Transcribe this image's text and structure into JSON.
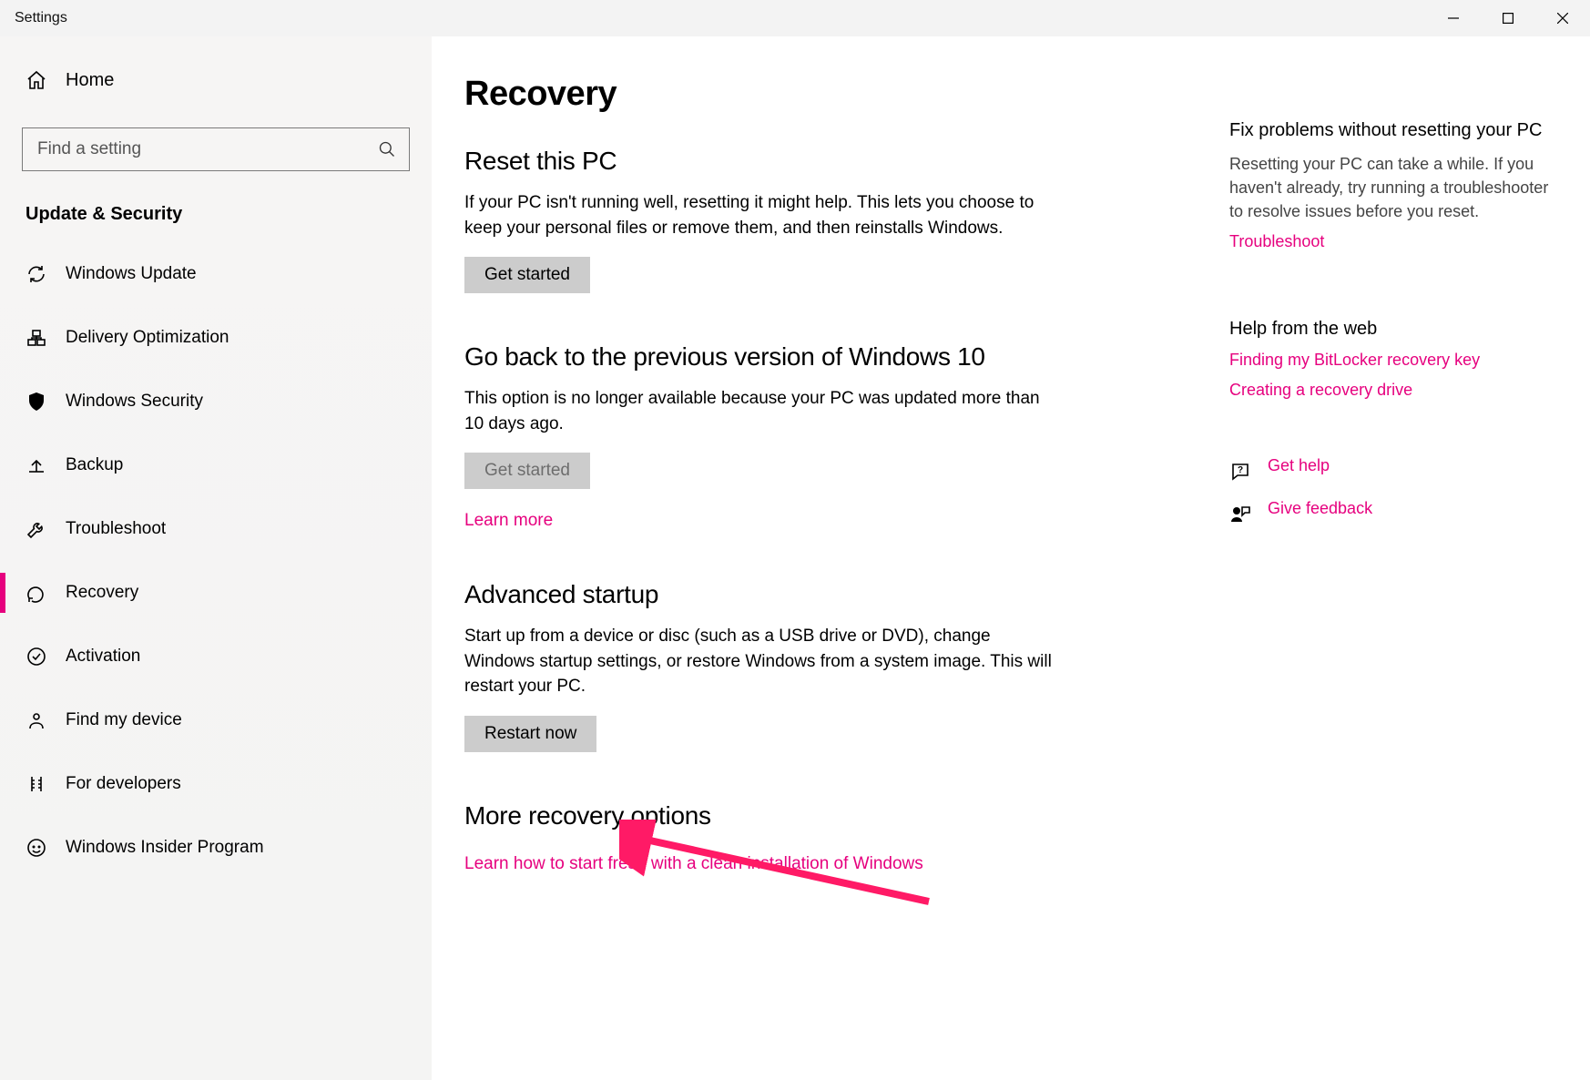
{
  "window": {
    "title": "Settings"
  },
  "sidebar": {
    "home_label": "Home",
    "search_placeholder": "Find a setting",
    "category_title": "Update & Security",
    "items": [
      {
        "label": "Windows Update"
      },
      {
        "label": "Delivery Optimization"
      },
      {
        "label": "Windows Security"
      },
      {
        "label": "Backup"
      },
      {
        "label": "Troubleshoot"
      },
      {
        "label": "Recovery"
      },
      {
        "label": "Activation"
      },
      {
        "label": "Find my device"
      },
      {
        "label": "For developers"
      },
      {
        "label": "Windows Insider Program"
      }
    ],
    "active_index": 5
  },
  "main": {
    "page_title": "Recovery",
    "reset": {
      "title": "Reset this PC",
      "body": "If your PC isn't running well, resetting it might help. This lets you choose to keep your personal files or remove them, and then reinstalls Windows.",
      "button": "Get started"
    },
    "goback": {
      "title": "Go back to the previous version of Windows 10",
      "body": "This option is no longer available because your PC was updated more than 10 days ago.",
      "button": "Get started",
      "learn_more": "Learn more"
    },
    "advanced": {
      "title": "Advanced startup",
      "body": "Start up from a device or disc (such as a USB drive or DVD), change Windows startup settings, or restore Windows from a system image. This will restart your PC.",
      "button": "Restart now"
    },
    "more": {
      "title": "More recovery options",
      "link": "Learn how to start fresh with a clean installation of Windows"
    }
  },
  "aside": {
    "fix": {
      "title": "Fix problems without resetting your PC",
      "body": "Resetting your PC can take a while. If you haven't already, try running a troubleshooter to resolve issues before you reset.",
      "link": "Troubleshoot"
    },
    "help_web": {
      "title": "Help from the web",
      "links": [
        "Finding my BitLocker recovery key",
        "Creating a recovery drive"
      ]
    },
    "support": {
      "get_help": "Get help",
      "give_feedback": "Give feedback"
    }
  },
  "colors": {
    "accent": "#e6007e"
  }
}
